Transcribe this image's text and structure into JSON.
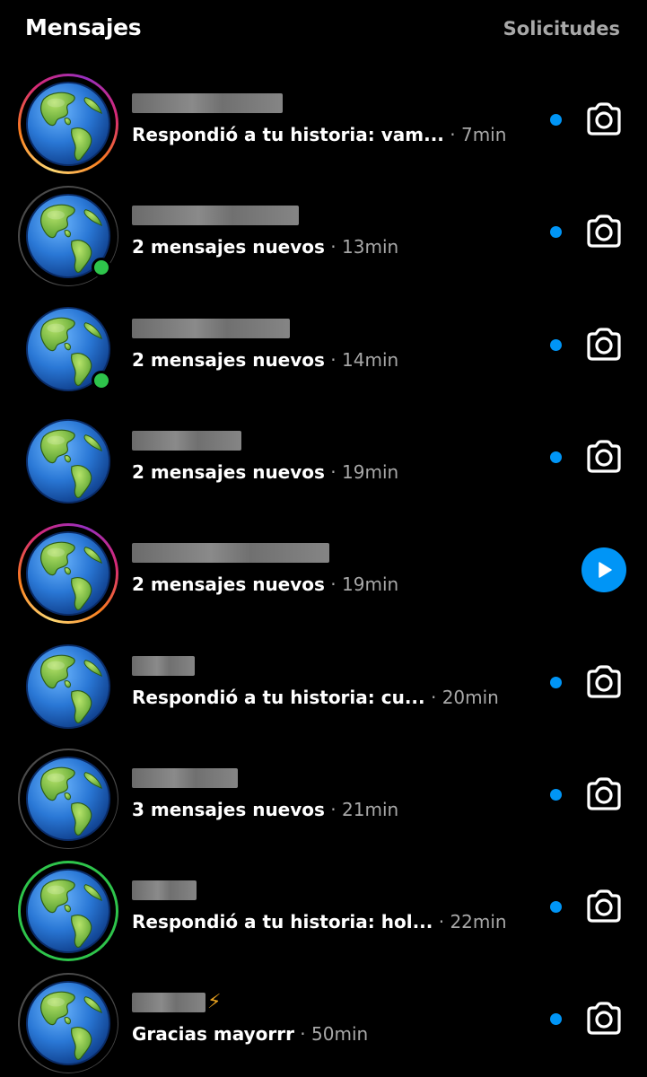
{
  "header": {
    "title": "Mensajes",
    "requests_label": "Solicitudes"
  },
  "colors": {
    "background": "#000000",
    "accent_blue": "#0095f6",
    "online_green": "#2ec44b",
    "muted_text": "#a8a8a8"
  },
  "conversations": [
    {
      "avatar": "globe-avatar",
      "ring": "story",
      "online": false,
      "preview": "Respondió a tu historia: vam...",
      "time": "· 7min",
      "unread": true,
      "action": "camera-icon"
    },
    {
      "avatar": "globe-avatar",
      "ring": "seen",
      "online": true,
      "preview": "2 mensajes nuevos",
      "time": "· 13min",
      "unread": true,
      "action": "camera-icon"
    },
    {
      "avatar": "globe-avatar",
      "ring": "none",
      "online": true,
      "preview": "2 mensajes nuevos",
      "time": "· 14min",
      "unread": true,
      "action": "camera-icon"
    },
    {
      "avatar": "globe-avatar",
      "ring": "none",
      "online": false,
      "preview": "2 mensajes nuevos",
      "time": "· 19min",
      "unread": true,
      "action": "camera-icon"
    },
    {
      "avatar": "globe-avatar",
      "ring": "story",
      "online": false,
      "preview": "2 mensajes nuevos",
      "time": "· 19min",
      "unread": false,
      "action": "play-icon"
    },
    {
      "avatar": "globe-avatar",
      "ring": "none",
      "online": false,
      "preview": "Respondió a tu historia: cu...",
      "time": "· 20min",
      "unread": true,
      "action": "camera-icon"
    },
    {
      "avatar": "globe-avatar",
      "ring": "seen",
      "online": false,
      "preview": "3 mensajes nuevos",
      "time": "· 21min",
      "unread": true,
      "action": "camera-icon"
    },
    {
      "avatar": "globe-avatar",
      "ring": "close",
      "online": false,
      "preview": "Respondió a tu historia: hol...",
      "time": "· 22min",
      "unread": true,
      "action": "camera-icon"
    },
    {
      "avatar": "globe-avatar",
      "ring": "seen",
      "online": false,
      "name_suffix": "⚡",
      "preview": "Gracias mayorrr",
      "time": "· 50min",
      "unread": true,
      "action": "camera-icon"
    }
  ]
}
